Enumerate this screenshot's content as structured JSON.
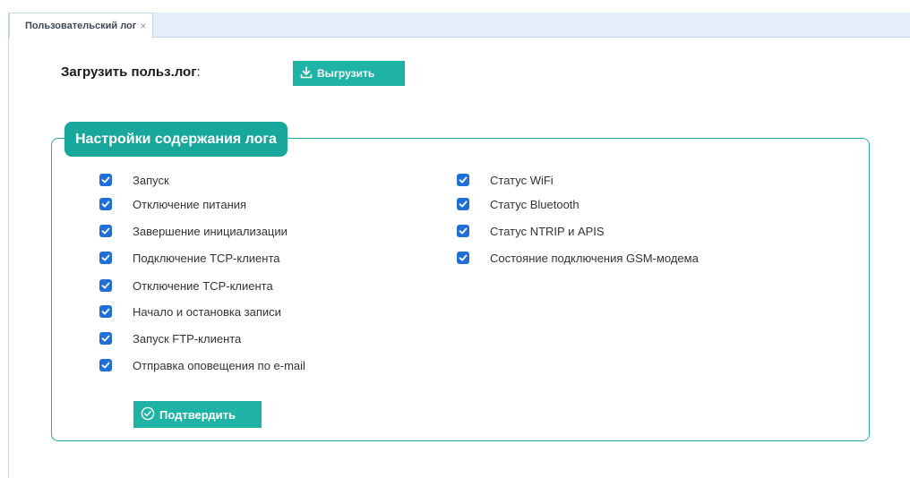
{
  "tab": {
    "title": "Пользовательский лог",
    "close_glyph": "×"
  },
  "upload": {
    "label": "Загрузить польз.лог",
    "colon": ":",
    "export_button": "Выгрузить",
    "export_icon": "download-icon"
  },
  "settings": {
    "title": "Настройки содержания лога",
    "left_items": [
      {
        "label": "Запуск",
        "checked": true
      },
      {
        "label": "Отключение питания",
        "checked": true
      },
      {
        "label": "Завершение инициализации",
        "checked": true
      },
      {
        "label": "Подключение TCP-клиента",
        "checked": true
      },
      {
        "label": "Отключение TCP-клиента",
        "checked": true
      },
      {
        "label": "Начало и остановка записи",
        "checked": true
      },
      {
        "label": "Запуск FTP-клиента",
        "checked": true
      },
      {
        "label": "Отправка оповещения по e-mail",
        "checked": true
      }
    ],
    "right_items": [
      {
        "label": "Статус WiFi",
        "checked": true
      },
      {
        "label": "Статус Bluetooth",
        "checked": true
      },
      {
        "label": "Статус NTRIP и APIS",
        "checked": true
      },
      {
        "label": "Состояние подключения GSM-модема",
        "checked": true
      }
    ],
    "confirm_button": "Подтвердить",
    "confirm_icon": "check-circle-icon"
  },
  "colors": {
    "accent": "#17a89b",
    "button": "#1fb3a6",
    "checkbox": "#1f6fd6",
    "tab_strip": "#e4eef8"
  }
}
